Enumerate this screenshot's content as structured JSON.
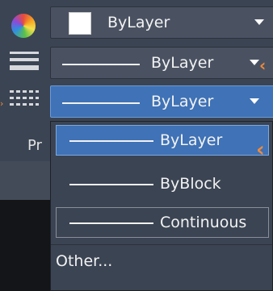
{
  "properties": {
    "color_combo": {
      "label": "ByLayer"
    },
    "lineweight_combo": {
      "label": "ByLayer"
    },
    "linetype_combo": {
      "label": "ByLayer"
    },
    "panel_label": "Pr"
  },
  "linetype_dropdown": {
    "options": [
      {
        "label": "ByLayer",
        "selected": true
      },
      {
        "label": "ByBlock",
        "selected": false
      },
      {
        "label": "Continuous",
        "selected": false
      }
    ],
    "other_label": "Other..."
  },
  "colors": {
    "accent_blue": "#3f72b6",
    "annotation_orange": "#f08a3a"
  }
}
